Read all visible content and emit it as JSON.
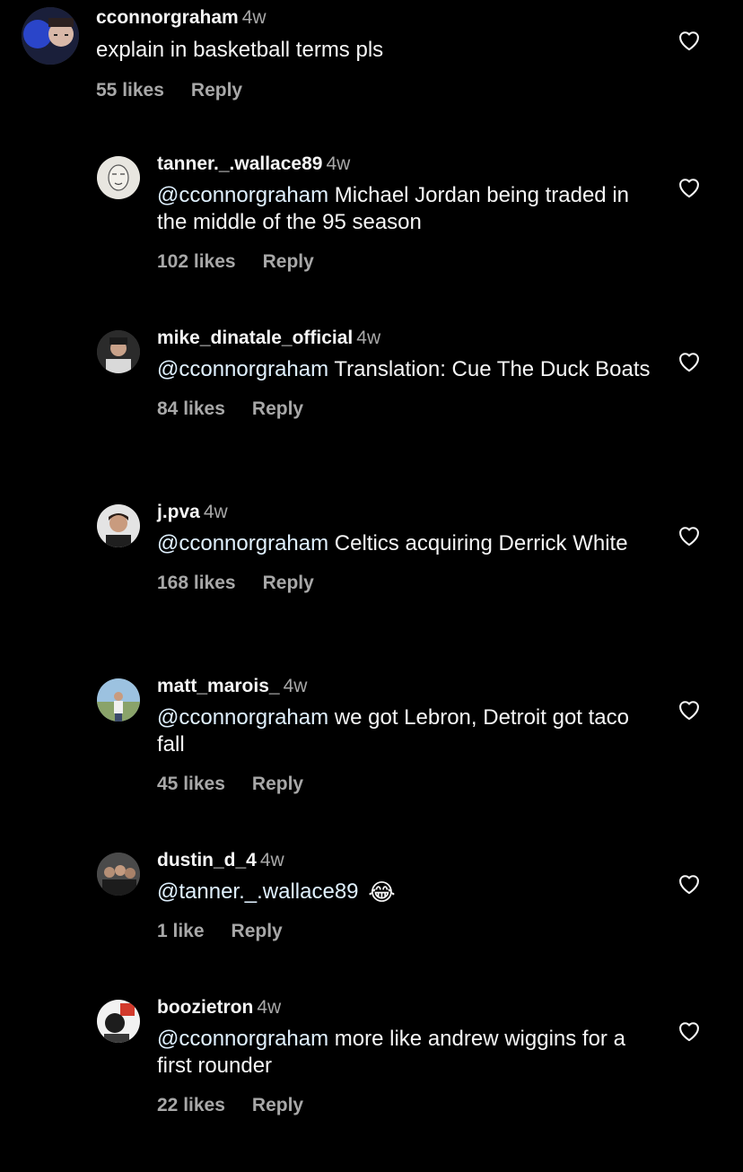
{
  "colors": {
    "background": "#000000",
    "text_primary": "#f5f5f5",
    "text_secondary": "#a8a8a8",
    "mention": "#e0f1ff"
  },
  "comments": [
    {
      "username": "cconnorgraham",
      "age": "4w",
      "mention": "",
      "text": "explain in basketball terms pls",
      "emoji": "",
      "likes": "55 likes",
      "reply_label": "Reply",
      "like_icon": "heart-outline-icon"
    },
    {
      "username": "tanner._.wallace89",
      "age": "4w",
      "mention": "@cconnorgraham",
      "text": "Michael Jordan being traded in the middle of the 95 season",
      "emoji": "",
      "likes": "102 likes",
      "reply_label": "Reply",
      "like_icon": "heart-outline-icon"
    },
    {
      "username": "mike_dinatale_official",
      "age": "4w",
      "mention": "@cconnorgraham",
      "text": "Translation: Cue The Duck Boats",
      "emoji": "",
      "likes": "84 likes",
      "reply_label": "Reply",
      "like_icon": "heart-outline-icon"
    },
    {
      "username": "j.pva",
      "age": "4w",
      "mention": "@cconnorgraham",
      "text": "Celtics acquiring Derrick White",
      "emoji": "",
      "likes": "168 likes",
      "reply_label": "Reply",
      "like_icon": "heart-outline-icon"
    },
    {
      "username": "matt_marois_",
      "age": "4w",
      "mention": "@cconnorgraham",
      "text": "we got Lebron, Detroit got taco fall",
      "emoji": "",
      "likes": "45 likes",
      "reply_label": "Reply",
      "like_icon": "heart-outline-icon"
    },
    {
      "username": "dustin_d_4",
      "age": "4w",
      "mention": "@tanner._.wallace89",
      "text": "",
      "emoji": "😂",
      "likes": "1 like",
      "reply_label": "Reply",
      "like_icon": "heart-outline-icon"
    },
    {
      "username": "boozietron",
      "age": "4w",
      "mention": "@cconnorgraham",
      "text": "more like andrew wiggins for a first rounder",
      "emoji": "",
      "likes": "22 likes",
      "reply_label": "Reply",
      "like_icon": "heart-outline-icon"
    }
  ]
}
